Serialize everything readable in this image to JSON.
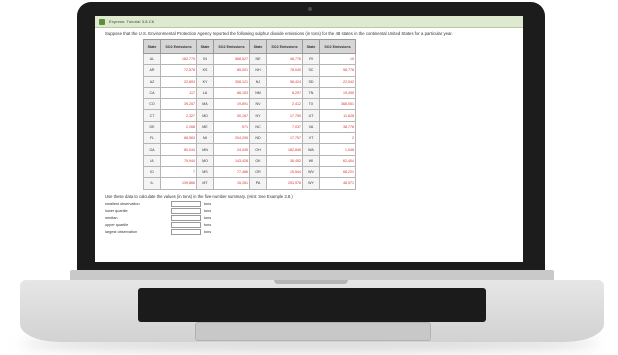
{
  "window": {
    "title": "Express: Tutorial 3.8.C6"
  },
  "prompt": "Suppose that the U.S. Environmental Protection Agency reported the following sulphur dioxide emissions (in tons) for the 48 states in the continental United States for a particular year.",
  "table": {
    "headers": [
      "State",
      "SO2 Emissions",
      "State",
      "SO2 Emissions",
      "State",
      "SO2 Emissions",
      "State",
      "SO2 Emissions"
    ],
    "rows": [
      [
        "AL",
        "182,775",
        "IN",
        "568,527",
        "NE",
        "48,776",
        "RI",
        "15"
      ],
      [
        "AR",
        "72,578",
        "KS",
        "85,001",
        "NH",
        "78,040",
        "SC",
        "98,778"
      ],
      [
        "AZ",
        "22,893",
        "KY",
        "308,121",
        "NJ",
        "58,424",
        "SD",
        "22,542"
      ],
      [
        "CA",
        "117",
        "LA",
        "88,153",
        "NM",
        "8,297",
        "TN",
        "19,495"
      ],
      [
        "CO",
        "39,257",
        "MA",
        "19,891",
        "NV",
        "2,412",
        "TX",
        "368,051"
      ],
      [
        "CT",
        "2,327",
        "MD",
        "50,167",
        "NY",
        "17,750",
        "UT",
        "11,628"
      ],
      [
        "DE",
        "2,268",
        "ME",
        "971",
        "NC",
        "7,037",
        "VA",
        "38,778"
      ],
      [
        "FL",
        "88,563",
        "MI",
        "204,295",
        "ND",
        "17,757",
        "VT",
        "2"
      ],
      [
        "GA",
        "80,044",
        "MN",
        "24,445",
        "OH",
        "182,846",
        "WA",
        "1,048"
      ],
      [
        "IA",
        "79,944",
        "MO",
        "143,428",
        "OK",
        "36,452",
        "WI",
        "62,404"
      ],
      [
        "ID",
        "7",
        "MS",
        "77,486",
        "OR",
        "15,544",
        "WV",
        "68,221"
      ],
      [
        "IL",
        "139,866",
        "MT",
        "15,281",
        "PA",
        "253,578",
        "WY",
        "48,571"
      ]
    ]
  },
  "question": "Use these data to calculate the values (in tons) in the five-number summary. (Hint: See Example 3.8.)",
  "answers": [
    {
      "label": "smallest observation",
      "unit": "tons"
    },
    {
      "label": "lower quartile",
      "unit": "tons"
    },
    {
      "label": "median",
      "unit": "tons"
    },
    {
      "label": "upper quartile",
      "unit": "tons"
    },
    {
      "label": "largest observation",
      "unit": "tons"
    }
  ],
  "colors": {
    "value_text": "#d4342f",
    "titlebar": "#dfe9d0",
    "header_bg": "#d6d6d6"
  }
}
